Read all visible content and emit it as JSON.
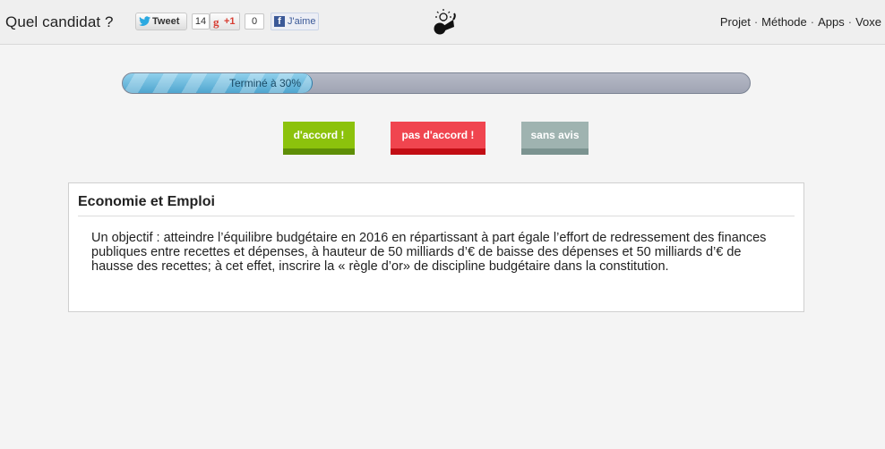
{
  "header": {
    "site_title": "Quel candidat ?",
    "social": {
      "tweet_label": "Tweet",
      "tweet_count": "14",
      "gplus_label": "+1",
      "gplus_count": "0",
      "facebook_label": "J'aime"
    },
    "nav": [
      {
        "label": "Projet"
      },
      {
        "label": "Méthode"
      },
      {
        "label": "Apps"
      },
      {
        "label": "Voxe"
      }
    ],
    "nav_separator": "·"
  },
  "progress": {
    "label": "Terminé à 30%",
    "fraction": 0.3
  },
  "votes": {
    "agree_label": "d'accord !",
    "disagree_label": "pas d'accord !",
    "neutral_label": "sans avis"
  },
  "question": {
    "topic": "Economie et Emploi",
    "text": "Un objectif : atteindre l’équilibre budgétaire en 2016 en répartissant à part égale l’effort de redressement des finances publiques entre recettes et dépenses, à hauteur de 50 milliards d’€ de baisse des dépenses et 50 milliards d’€ de hausse des recettes; à cet effet, inscrire la « règle d’or» de discipline budgétaire dans la constitution."
  },
  "colors": {
    "agree": "#8cc20c",
    "disagree": "#f0454f",
    "neutral": "#9fb3b0",
    "progress_fill": "#4fa5cf"
  }
}
